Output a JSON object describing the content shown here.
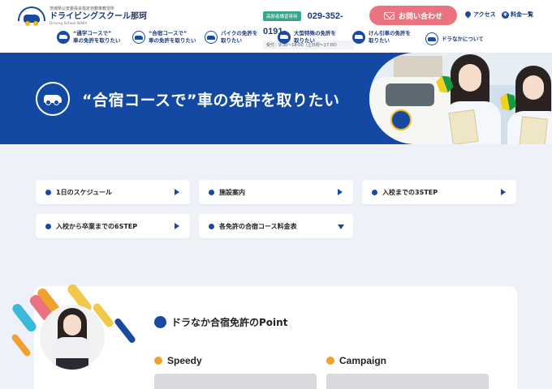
{
  "header": {
    "logo_sub": "茨城県公安委員会指定自動車教習所",
    "logo_main": "ドライビングスクール那珂",
    "logo_en": "Driving School NAKA",
    "phone_tag": "高齢者講習専用",
    "phone_number": "029-352-0191",
    "phone_hours": "受付：9:30〜18:00（土日祝〜17:00）",
    "contact_label": "お問い合わせ",
    "access_label": "アクセス",
    "price_label": "料金一覧"
  },
  "nav": {
    "items": [
      {
        "label": "“通学コースで”\n車の免許を取りたい",
        "icon": "car-icon"
      },
      {
        "label": "“合宿コースで”\n車の免許を取りたい",
        "icon": "car-icon"
      },
      {
        "label": "バイクの免許を\n取りたい",
        "icon": "motorcycle-icon"
      },
      {
        "label": "大型特殊の免許を\n取りたい",
        "icon": "truck-icon"
      },
      {
        "label": "けん引車の免許を\n取りたい",
        "icon": "trailer-icon"
      },
      {
        "label": "ドラなかについて",
        "icon": "school-icon"
      }
    ]
  },
  "hero": {
    "title": "“合宿コースで”車の免許を取りたい"
  },
  "menu": {
    "items": [
      {
        "label": "1日のスケジュール",
        "arrow": "right"
      },
      {
        "label": "施設案内",
        "arrow": "right"
      },
      {
        "label": "入校までの3STEP",
        "arrow": "right"
      },
      {
        "label": "入校から卒業までの6STEP",
        "arrow": "right"
      },
      {
        "label": "各免許の合宿コース料金表",
        "arrow": "down"
      }
    ]
  },
  "points": {
    "title": "ドラなか合宿免許のPoint",
    "items": [
      {
        "label": "Speedy"
      },
      {
        "label": "Campaign"
      }
    ]
  },
  "colors": {
    "primary_blue": "#1348a3",
    "accent_pink": "#e9737e",
    "accent_orange": "#f0a22e",
    "tag_green": "#3aa58a"
  }
}
